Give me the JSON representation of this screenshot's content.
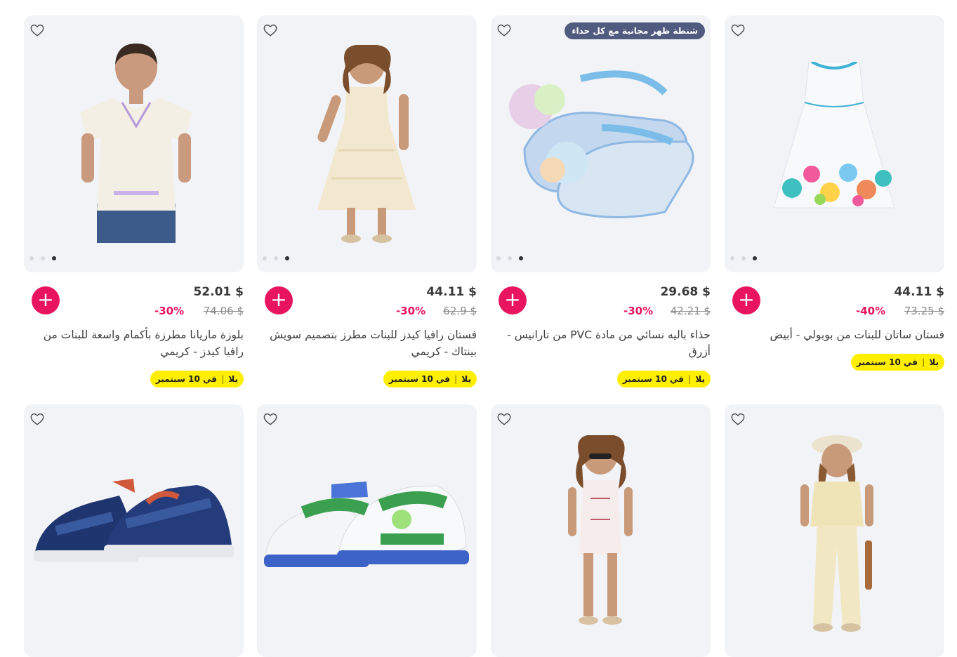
{
  "row1": [
    {
      "price": "52.01 $",
      "old_price": "74.06 $",
      "discount": "-30%",
      "title": "بلوزة ماريانا مطرزة بأكمام واسعة للبنات من رافيا كيدز - كريمي",
      "badge_brand": "يلا",
      "badge_delivery": "في 10 سبتمبر",
      "promo": ""
    },
    {
      "price": "44.11 $",
      "old_price": "62.9 $",
      "discount": "-30%",
      "title": "فستان رافيا كيدز للبنات مطرز بتصميم سويش بينتاك - كريمي",
      "badge_brand": "يلا",
      "badge_delivery": "في 10 سبتمبر",
      "promo": ""
    },
    {
      "price": "29.68 $",
      "old_price": "42.21 $",
      "discount": "-30%",
      "title": "حذاء باليه نسائي من مادة PVC من تارانيس - أزرق",
      "badge_brand": "يلا",
      "badge_delivery": "في 10 سبتمبر",
      "promo": "شنطة ظهر مجانية مع كل حذاء"
    },
    {
      "price": "44.11 $",
      "old_price": "73.25 $",
      "discount": "-40%",
      "title": "فستان ساتان للبنات من بوبولي - أبيض",
      "badge_brand": "يلا",
      "badge_delivery": "في 10 سبتمبر",
      "promo": ""
    }
  ],
  "icons": {
    "wishlist": "heart-outline-icon",
    "add": "plus-icon"
  },
  "colors": {
    "accent": "#e8155e",
    "badge": "#feee00",
    "promo_bg": "#505b7f",
    "card_bg": "#f2f3f6"
  }
}
